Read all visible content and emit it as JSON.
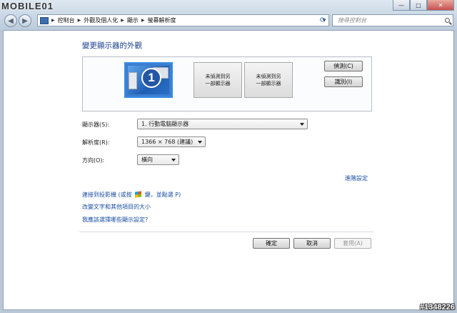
{
  "watermark": {
    "brand": "MOBILE01",
    "id": "#1348226"
  },
  "window_controls": {
    "minimize": "—",
    "maximize": "□",
    "close": "✕"
  },
  "address_bar": {
    "breadcrumbs": [
      "控制台",
      "外觀及個人化",
      "顯示",
      "螢幕解析度"
    ]
  },
  "search": {
    "placeholder": "搜尋控制台"
  },
  "page": {
    "title": "變更顯示器的外觀",
    "monitors": [
      {
        "number": "1",
        "selected": true
      },
      {
        "line1": "未偵測到另",
        "line2": "一部顯示器"
      },
      {
        "line1": "未偵測到另",
        "line2": "一部顯示器"
      }
    ],
    "detect_button": "偵測(C)",
    "identify_button": "識別(I)",
    "display_label": "顯示器(S):",
    "display_value": "1. 行動電腦顯示器",
    "resolution_label": "解析度(R):",
    "resolution_value": "1366 × 768 (建議)",
    "orientation_label": "方向(O):",
    "orientation_value": "橫向",
    "advanced_link": "進階設定",
    "projector_link_prefix": "連接到投影機 (或按",
    "projector_link_suffix": "鍵，並點選 P)",
    "text_size_link": "改變文字和其他項目的大小",
    "which_settings_link": "我應該選擇哪些顯示設定?",
    "ok_button": "確定",
    "cancel_button": "取消",
    "apply_button": "套用(A)"
  },
  "colors": {
    "link": "#1a4fa0",
    "title": "#1a3f8c",
    "selected_monitor": "#3a7fd0"
  }
}
